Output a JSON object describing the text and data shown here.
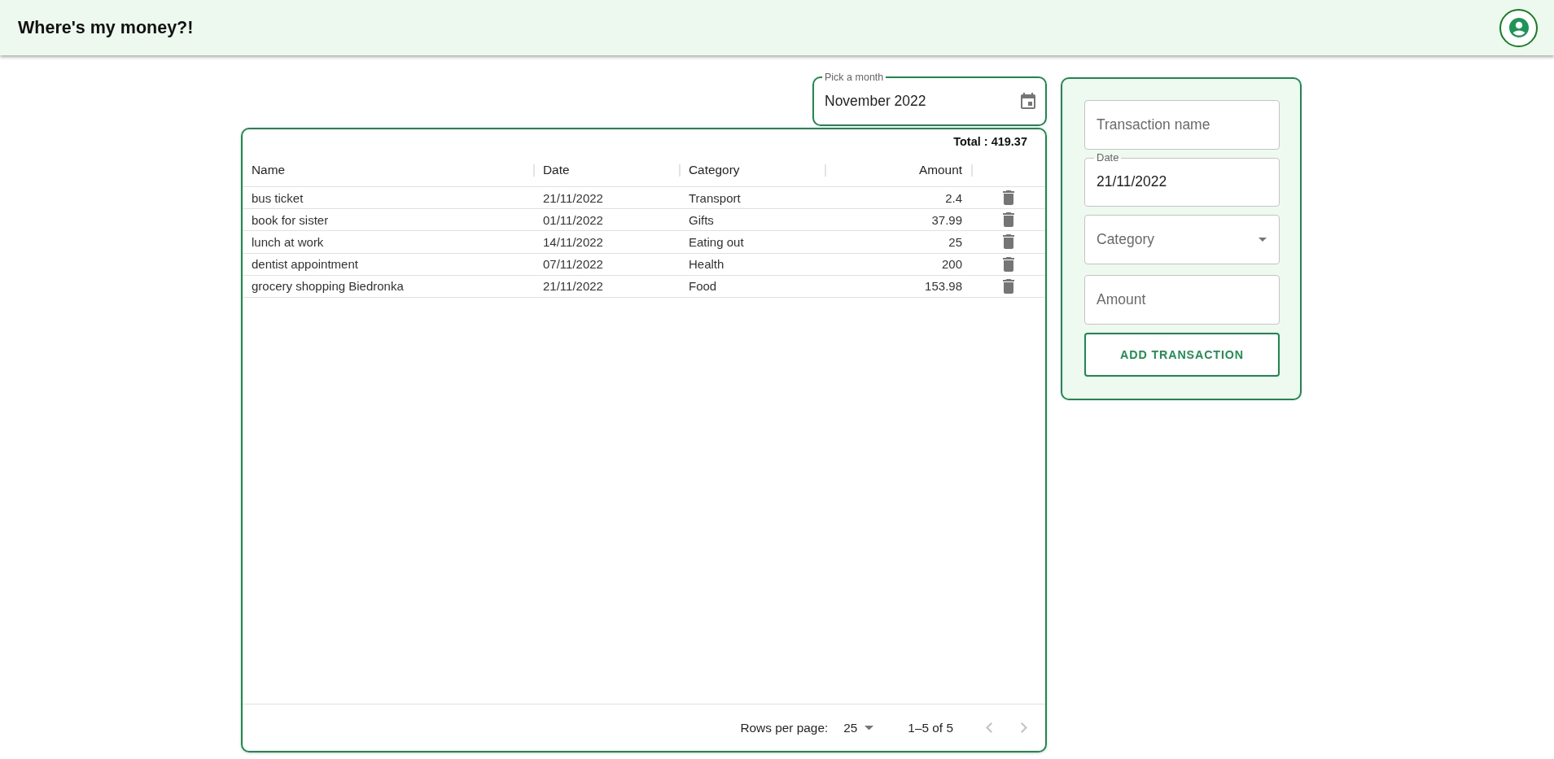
{
  "app_bar": {
    "title": "Where's my money?!"
  },
  "month_picker": {
    "label": "Pick a month",
    "value": "November 2022"
  },
  "transactions_table": {
    "total": "Total : 419.37",
    "columns": [
      {
        "label": "Name",
        "kind": "text"
      },
      {
        "label": "Date",
        "kind": "text"
      },
      {
        "label": "Category",
        "kind": "text"
      },
      {
        "label": "Amount",
        "kind": "number"
      }
    ],
    "rows": [
      {
        "cells": [
          "bus ticket",
          "21/11/2022",
          "Transport",
          "2.4"
        ]
      },
      {
        "cells": [
          "book for sister",
          "01/11/2022",
          "Gifts",
          "37.99"
        ]
      },
      {
        "cells": [
          "lunch at work",
          "14/11/2022",
          "Eating out",
          "25"
        ]
      },
      {
        "cells": [
          "dentist appointment",
          "07/11/2022",
          "Health",
          "200"
        ]
      },
      {
        "cells": [
          "grocery shopping Biedronka",
          "21/11/2022",
          "Food",
          "153.98"
        ]
      }
    ],
    "pagination": {
      "rows_per_page_label": "Rows per page:",
      "rows_per_page": "25",
      "range": "1–5 of 5",
      "previous": {
        "disabled": true
      },
      "next": {
        "disabled": true
      }
    }
  },
  "transaction_form": {
    "fields": [
      {
        "kind": "text",
        "placeholder": "Transaction name"
      },
      {
        "kind": "date",
        "label": "Date",
        "value": "21/11/2022"
      },
      {
        "kind": "select",
        "placeholder": "Category"
      },
      {
        "kind": "text",
        "placeholder": "Amount"
      }
    ],
    "submit": "ADD TRANSACTION"
  }
}
